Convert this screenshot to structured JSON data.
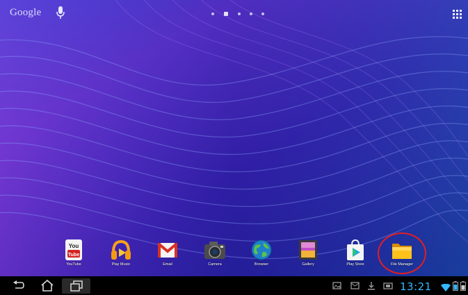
{
  "status_bar": {
    "search_label": "Google",
    "time": "13:21"
  },
  "dock": {
    "apps": [
      {
        "label": "YouTube",
        "icon": "youtube-icon"
      },
      {
        "label": "Play Music",
        "icon": "headphones-icon"
      },
      {
        "label": "Email",
        "icon": "gmail-icon"
      },
      {
        "label": "Camera",
        "icon": "camera-icon"
      },
      {
        "label": "Browser",
        "icon": "globe-icon"
      },
      {
        "label": "Gallery",
        "icon": "gallery-icon"
      },
      {
        "label": "Play Store",
        "icon": "play-store-icon"
      },
      {
        "label": "File Manager",
        "icon": "folder-icon"
      }
    ]
  },
  "highlight": {
    "target": "File Manager",
    "color": "#e21e22"
  },
  "colors": {
    "accent": "#35b8ff",
    "navbar": "#000000",
    "wallpaper_top": "#3a2fb0",
    "wallpaper_bottom": "#06146a"
  }
}
